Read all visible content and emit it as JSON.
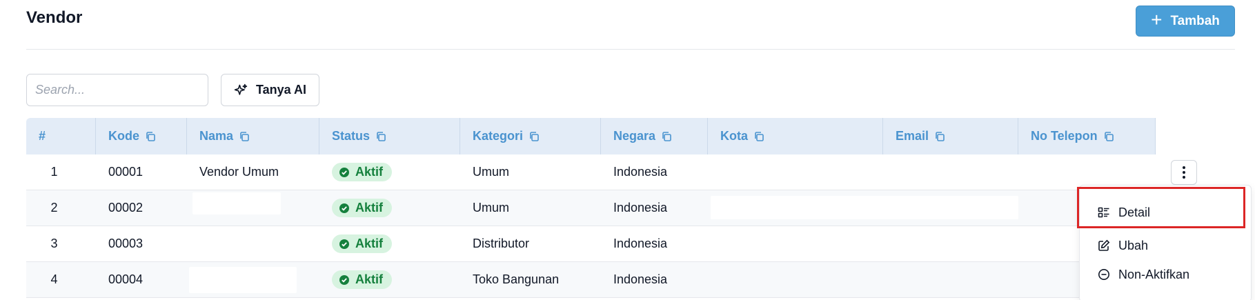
{
  "header": {
    "title": "Vendor",
    "add_label": "Tambah"
  },
  "toolbar": {
    "search_placeholder": "Search...",
    "ai_label": "Tanya AI"
  },
  "table": {
    "columns": [
      "#",
      "Kode",
      "Nama",
      "Status",
      "Kategori",
      "Negara",
      "Kota",
      "Email",
      "No Telepon"
    ],
    "rows": [
      {
        "no": "1",
        "kode": "00001",
        "nama": "Vendor Umum",
        "status": "Aktif",
        "kategori": "Umum",
        "negara": "Indonesia"
      },
      {
        "no": "2",
        "kode": "00002",
        "nama": "",
        "status": "Aktif",
        "kategori": "Umum",
        "negara": "Indonesia"
      },
      {
        "no": "3",
        "kode": "00003",
        "nama": "",
        "status": "Aktif",
        "kategori": "Distributor",
        "negara": "Indonesia"
      },
      {
        "no": "4",
        "kode": "00004",
        "nama": "",
        "status": "Aktif",
        "kategori": "Toko Bangunan",
        "negara": "Indonesia"
      }
    ]
  },
  "menu": {
    "items": [
      "Detail",
      "Ubah",
      "Non-Aktifkan"
    ]
  },
  "colors": {
    "accent": "#4a9fd8",
    "header_text": "#4a93cf",
    "badge_bg": "#d7f3e0",
    "badge_text": "#15803d",
    "highlight": "#dc2626"
  }
}
